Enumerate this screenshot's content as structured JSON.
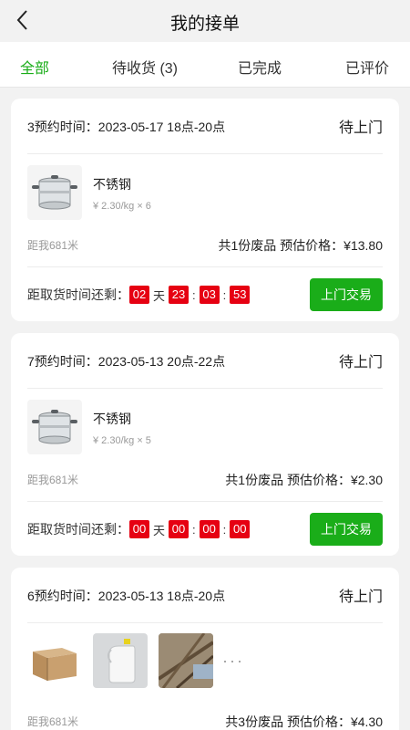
{
  "header": {
    "title": "我的接单"
  },
  "tabs": [
    {
      "label": "全部",
      "active": true
    },
    {
      "label": "待收货 (3)",
      "active": false
    },
    {
      "label": "已完成",
      "active": false
    },
    {
      "label": "已评价",
      "active": false
    }
  ],
  "orders": [
    {
      "appointment": "3预约时间：2023-05-17 18点-20点",
      "status": "待上门",
      "items": [
        {
          "name": "不锈钢",
          "price": "¥ 2.30/kg × 6",
          "icon": "steamer-pot-image"
        }
      ],
      "distance": "距我681米",
      "summary": "共1份废品 预估价格：¥13.80",
      "countdown_label": "距取货时间还剩：",
      "countdown": {
        "days": "02",
        "day_unit": "天",
        "hours": "23",
        "minutes": "03",
        "seconds": "53"
      },
      "action_label": "上门交易"
    },
    {
      "appointment": "7预约时间：2023-05-13 20点-22点",
      "status": "待上门",
      "items": [
        {
          "name": "不锈钢",
          "price": "¥ 2.30/kg × 5",
          "icon": "steamer-pot-image"
        }
      ],
      "distance": "距我681米",
      "summary": "共1份废品 预估价格：¥2.30",
      "countdown_label": "距取货时间还剩：",
      "countdown": {
        "days": "00",
        "day_unit": "天",
        "hours": "00",
        "minutes": "00",
        "seconds": "00"
      },
      "action_label": "上门交易"
    },
    {
      "appointment": "6预约时间：2023-05-13 18点-20点",
      "status": "待上门",
      "thumbnails": [
        "cardboard-box-image",
        "plastic-jug-image",
        "scrap-wood-image"
      ],
      "more": "···",
      "distance": "距我681米",
      "summary": "共3份废品 预估价格：¥4.30"
    }
  ],
  "colors": {
    "accent": "#1aad19",
    "countdown": "#e60012"
  }
}
